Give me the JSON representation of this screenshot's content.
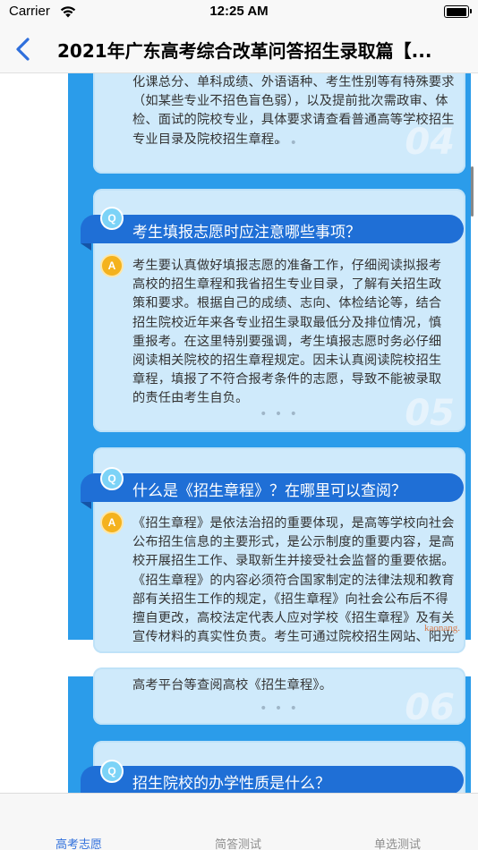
{
  "status_bar": {
    "carrier": "Carrier",
    "time": "12:25 AM"
  },
  "nav": {
    "title": "2021年广东高考综合改革问答招生录取篇【..."
  },
  "sections": [
    {
      "number": "04",
      "answer_lines": [
        "化课总分、单科成绩、外语语种、考生性别等有特殊要求",
        "（如某些专业不招色盲色弱），以及提前批次需政审、体",
        "检、面试的院校专业，具体要求请查看普通高等学校招生",
        "专业目录及院校招生章程。"
      ]
    },
    {
      "number": "05",
      "question": "考生填报志愿时应注意哪些事项？",
      "answer_lines": [
        "考生要认真做好填报志愿的准备工作，仔细阅读拟报考",
        "高校的招生章程和我省招生专业目录，了解有关招生政",
        "策和要求。根据自己的成绩、志向、体检结论等，结合",
        "招生院校近年来各专业招生录取最低分及排位情况，慎",
        "重报考。在这里特别要强调，考生填报志愿时务必仔细",
        "阅读相关院校的招生章程规定。因未认真阅读院校招生",
        "章程，填报了不符合报考条件的志愿，导致不能被录取",
        "的责任由考生自负。"
      ]
    },
    {
      "number": "06",
      "question": "什么是《招生章程》？在哪里可以查阅？",
      "answer_lines": [
        "《招生章程》是依法治招的重要体现，是高等学校向社会",
        "公布招生信息的主要形式，是公示制度的重要内容，是高",
        "校开展招生工作、录取新生并接受社会监督的重要依据。",
        "《招生章程》的内容必须符合国家制定的法律法规和教育",
        "部有关招生工作的规定，《招生章程》向社会公布后不得",
        "擅自更改，高校法定代表人应对学校《招生章程》及有关",
        "宣传材料的真实性负责。考生可通过院校招生网站、阳光"
      ],
      "continued_line": "高考平台等查阅高校《招生章程》。"
    },
    {
      "question": "招生院校的办学性质是什么？"
    }
  ],
  "badges": {
    "question": "Q",
    "answer": "A"
  },
  "dots": "• • •",
  "watermark": "kaonang.",
  "tabs": [
    {
      "label": "高考志愿",
      "active": true
    },
    {
      "label": "简答测试",
      "active": false
    },
    {
      "label": "单选测试",
      "active": false
    }
  ],
  "colors": {
    "panel_blue": "#2b9cea",
    "question_bar": "#1f6fd6",
    "card_bg": "#cfeafb",
    "answer_badge": "#f4b21e",
    "tab_active": "#2f6fdc",
    "back_arrow": "#2f6fdc"
  }
}
